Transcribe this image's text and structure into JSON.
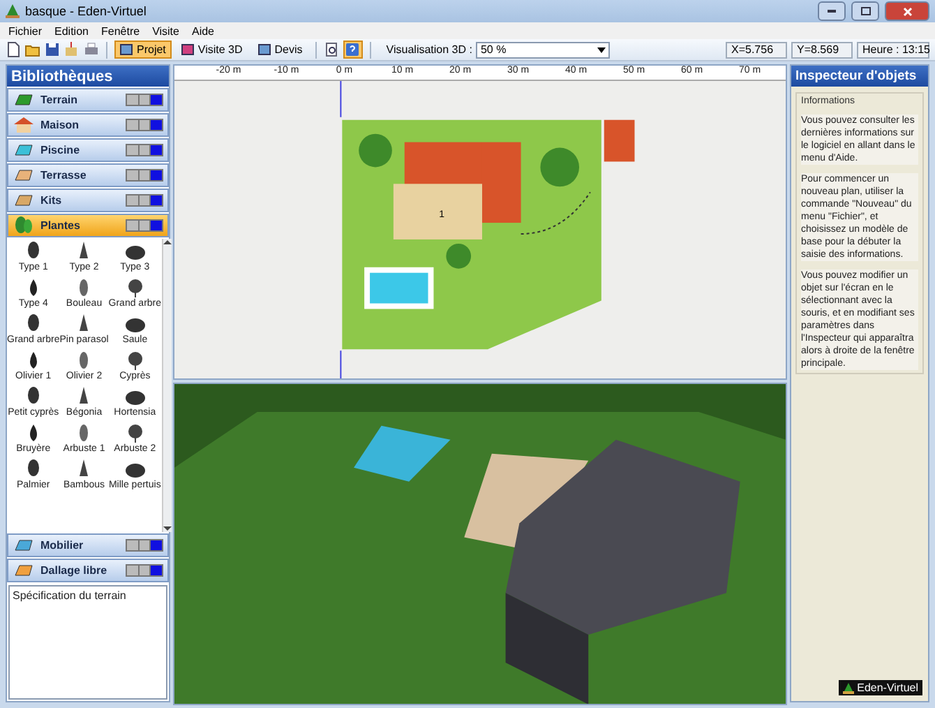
{
  "window": {
    "title": "basque - Eden-Virtuel"
  },
  "menu": [
    "Fichier",
    "Edition",
    "Fenêtre",
    "Visite",
    "Aide"
  ],
  "toolbar": {
    "modes": [
      {
        "label": "Projet",
        "selected": true
      },
      {
        "label": "Visite 3D",
        "selected": false
      },
      {
        "label": "Devis",
        "selected": false
      }
    ],
    "help_selected": true,
    "visualisation_label": "Visualisation 3D :",
    "visualisation_value": "50 %",
    "x": "X=5.756",
    "y": "Y=8.569",
    "time": "Heure : 13:15"
  },
  "library": {
    "title": "Bibliothèques",
    "categories": [
      {
        "kind": "terrain",
        "label": "Terrain",
        "expanded": false
      },
      {
        "kind": "maison",
        "label": "Maison",
        "expanded": false
      },
      {
        "kind": "piscine",
        "label": "Piscine",
        "expanded": false
      },
      {
        "kind": "terrasse",
        "label": "Terrasse",
        "expanded": false
      },
      {
        "kind": "kits",
        "label": "Kits",
        "expanded": false
      },
      {
        "kind": "plantes",
        "label": "Plantes",
        "expanded": true
      }
    ],
    "items": [
      "Type 1",
      "Type 2",
      "Type 3",
      "Type 4",
      "Bouleau",
      "Grand arbre",
      "Grand arbre",
      "Pin parasol",
      "Saule",
      "Olivier 1",
      "Olivier 2",
      "Cyprès",
      "Petit cyprès",
      "Bégonia",
      "Hortensia",
      "Bruyère",
      "Arbuste 1",
      "Arbuste 2",
      "Palmier",
      "Bambous",
      "Mille pertuis"
    ],
    "more_categories": [
      {
        "kind": "mobilier",
        "label": "Mobilier",
        "expanded": false
      },
      {
        "kind": "dallage",
        "label": "Dallage libre",
        "expanded": false
      }
    ],
    "description": "Spécification du terrain"
  },
  "ruler": [
    "-20 m",
    "-10 m",
    "0 m",
    "10 m",
    "20 m",
    "30 m",
    "40 m",
    "50 m",
    "60 m",
    "70 m"
  ],
  "plan": {
    "marker": "1"
  },
  "inspector": {
    "title": "Inspecteur d'objets",
    "group": "Informations",
    "paragraphs": [
      "Vous pouvez consulter les dernières informations sur le logiciel en allant dans le menu d'Aide.",
      "Pour commencer un nouveau plan, utiliser la commande \"Nouveau\" du menu \"Fichier\", et choisissez un modèle de base pour la débuter la saisie des informations.",
      "Vous pouvez modifier un objet sur l'écran en le sélectionnant avec la souris, et en modifiant ses paramètres dans l'Inspecteur qui apparaîtra alors à droite de la fenêtre principale."
    ],
    "logo": "Eden-Virtuel"
  }
}
